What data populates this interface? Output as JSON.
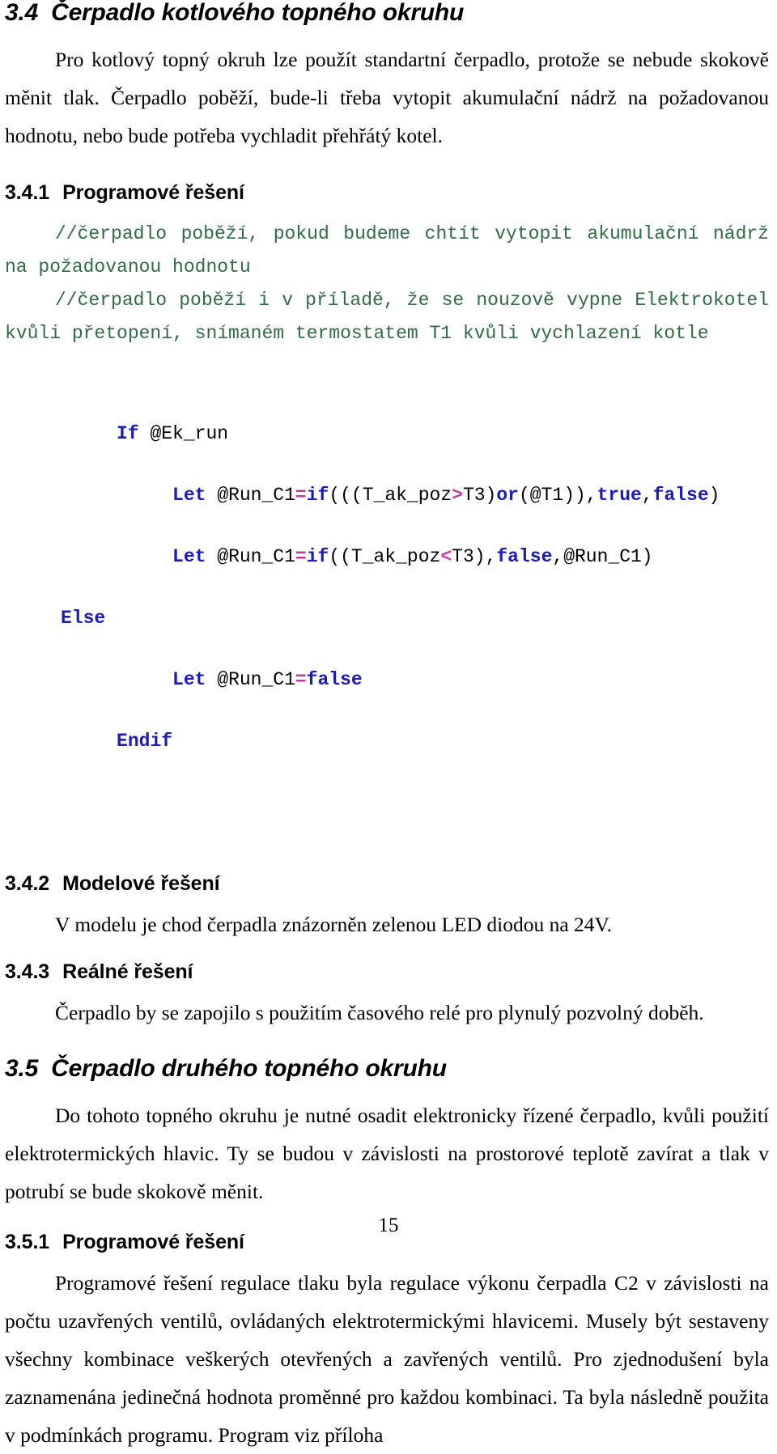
{
  "document": {
    "page_number": "15",
    "language": "cs"
  },
  "colors": {
    "text": "#000000",
    "comment_green": "#2f6b43",
    "keyword_blue": "#1a1ac0",
    "operator_magenta": "#c23aa0",
    "background": "#ffffff"
  },
  "sections": {
    "s34": {
      "number": "3.4",
      "title": "Čerpadlo kotlového topného okruhu",
      "paragraph": "Pro kotlový topný okruh lze použít standartní čerpadlo, protože se nebude skokově měnit tlak. Čerpadlo poběží, bude-li třeba vytopit akumulační nádrž na požadovanou hodnotu, nebo bude potřeba vychladit přehřátý kotel."
    },
    "s341": {
      "number": "3.4.1",
      "title": "Programové řešení",
      "comment_1": "//čerpadlo poběží, pokud budeme chtít vytopit akumulační nádrž na požadovanou hodnotu",
      "comment_2": "//čerpadlo poběží i v příladě, že se nouzově vypne Elektrokotel kvůli přetopení, snímaném termostatem T1 kvůli vychlazení kotle",
      "code": {
        "line_1": {
          "kw": "If",
          "rest": " @Ek_run"
        },
        "line_2": {
          "kw1": "Let",
          "t1": " @Run_C1",
          "op1": "=",
          "kw2": "if",
          "t2": "(((T_ak_poz",
          "op2": ">",
          "t3": "T3)",
          "kw3": "or",
          "t4": "(@T1)),",
          "kw4": "true",
          "t5": ",",
          "kw5": "false",
          "t6": ")"
        },
        "line_3": {
          "kw1": "Let",
          "t1": " @Run_C1",
          "op1": "=",
          "kw2": "if",
          "t2": "((T_ak_poz",
          "op2": "<",
          "t3": "T3),",
          "kw3": "false",
          "t4": ",@Run_C1)"
        },
        "line_4": {
          "kw": "Else"
        },
        "line_5": {
          "kw1": "Let",
          "t1": " @Run_C1",
          "op1": "=",
          "kw2": "false"
        },
        "line_6": {
          "kw": "Endif"
        }
      }
    },
    "s342": {
      "number": "3.4.2",
      "title": "Modelové řešení",
      "paragraph": "V modelu je chod čerpadla znázorněn zelenou LED diodou na 24V."
    },
    "s343": {
      "number": "3.4.3",
      "title": "Reálné řešení",
      "paragraph": "Čerpadlo by se zapojilo s použitím časového relé pro plynulý pozvolný doběh."
    },
    "s35": {
      "number": "3.5",
      "title": "Čerpadlo druhého topného okruhu",
      "paragraph": "Do tohoto topného okruhu je nutné osadit elektronicky řízené čerpadlo, kvůli použití elektrotermických hlavic. Ty se budou v závislosti na prostorové teplotě zavírat a tlak v potrubí se bude skokově měnit."
    },
    "s351": {
      "number": "3.5.1",
      "title": "Programové řešení",
      "paragraph": "Programové řešení regulace tlaku byla regulace výkonu čerpadla C2 v závislosti na počtu uzavřených ventilů, ovládaných elektrotermickými hlavicemi. Musely být sestaveny všechny kombinace veškerých otevřených a zavřených ventilů. Pro zjednodušení byla zaznamenána jedinečná hodnota proměnné pro každou kombinaci. Ta byla následně použita v podmínkách programu. Program viz příloha"
    }
  }
}
